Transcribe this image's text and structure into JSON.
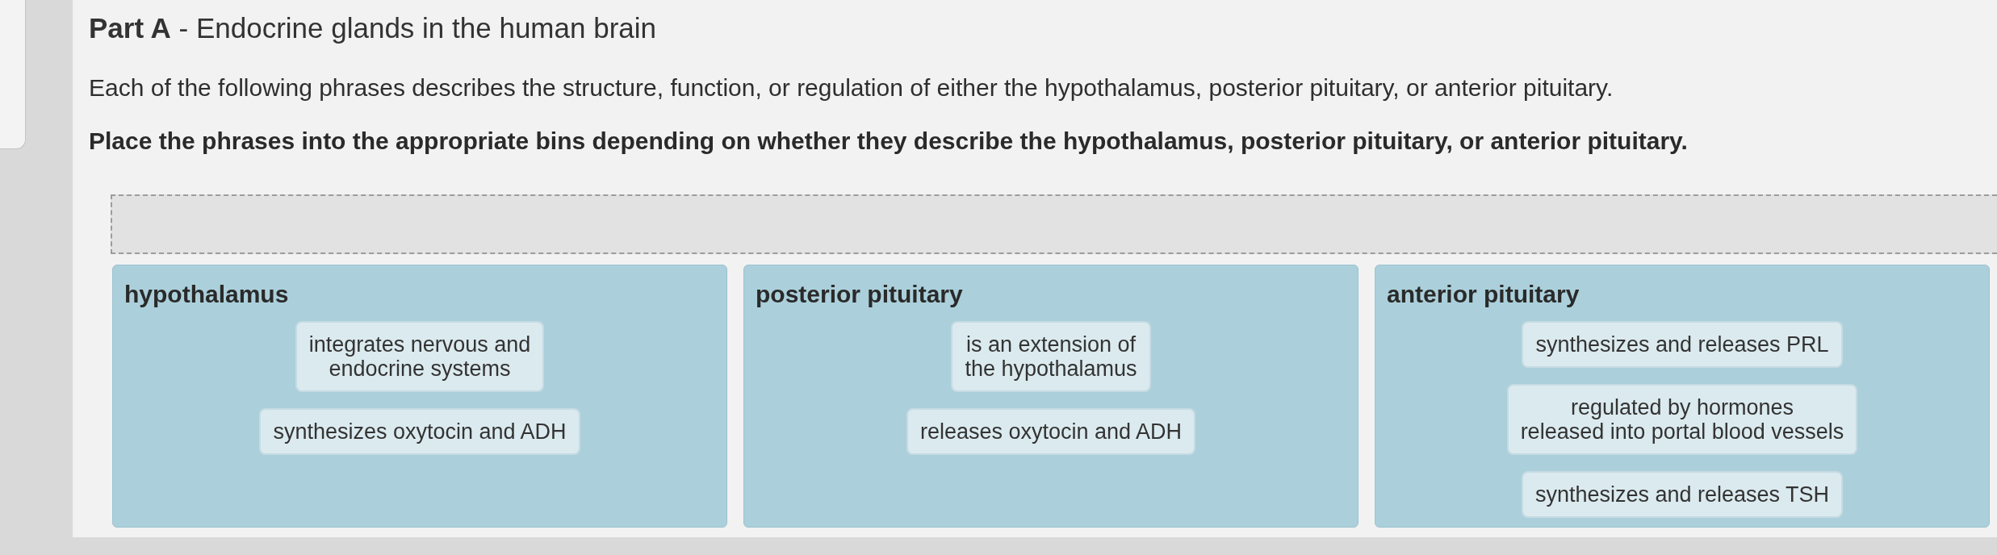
{
  "title": "**Part A** - Endocrine glands in the human brain",
  "description": "Each of the following phrases describes the structure, function, or regulation of either the hypothalamus, posterior pituitary, or anterior pituitary.",
  "instruction": "Place the phrases into the appropriate bins depending on whether they describe the hypothalamus, posterior pituitary, or anterior pituitary.",
  "bins": [
    {
      "label": "hypothalamus",
      "phrases": [
        "integrates nervous and\nendocrine systems",
        "synthesizes oxytocin and ADH"
      ]
    },
    {
      "label": "posterior pituitary",
      "phrases": [
        "is an extension of\nthe hypothalamus",
        "releases oxytocin and ADH"
      ]
    },
    {
      "label": "anterior pituitary",
      "phrases": [
        "synthesizes and releases PRL",
        "regulated by hormones\nreleased into portal blood vessels",
        "synthesizes and releases TSH"
      ]
    }
  ]
}
